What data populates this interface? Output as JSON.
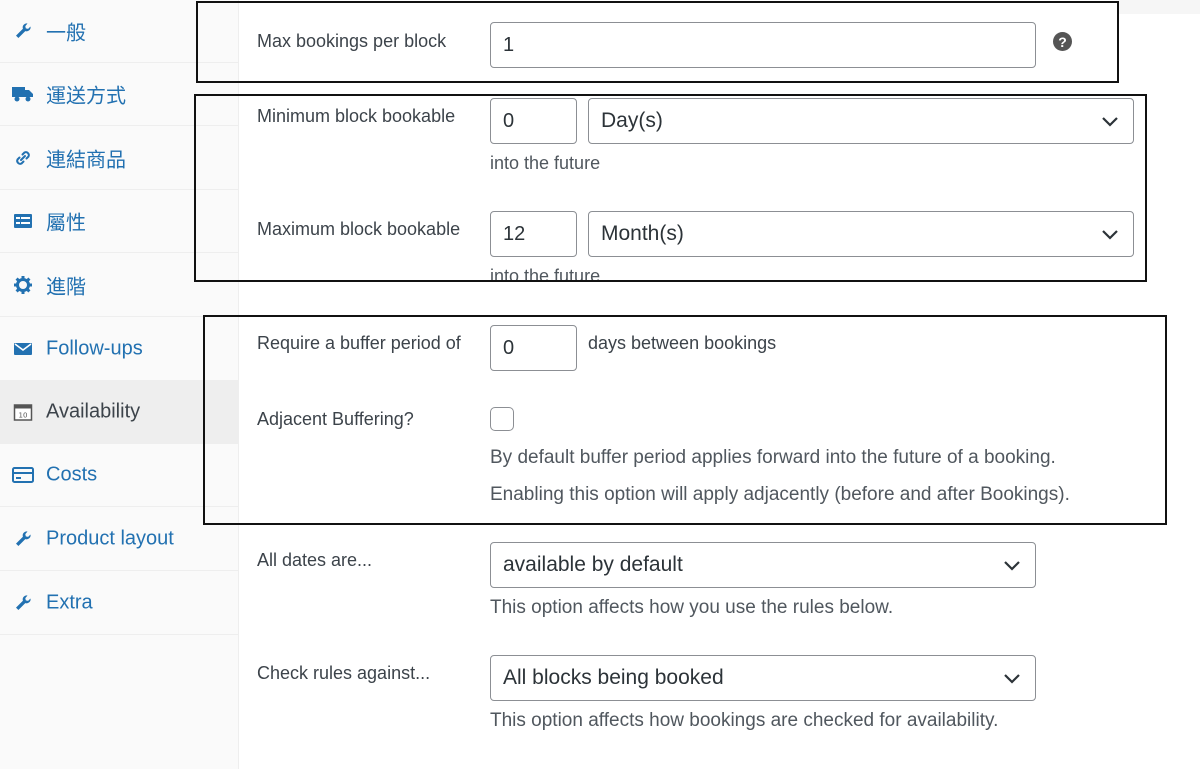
{
  "sidebar": {
    "items": [
      {
        "label": "一般",
        "icon": "wrench-icon"
      },
      {
        "label": "運送方式",
        "icon": "truck-icon"
      },
      {
        "label": "連結商品",
        "icon": "link-icon"
      },
      {
        "label": "屬性",
        "icon": "list-icon"
      },
      {
        "label": "進階",
        "icon": "gear-icon"
      },
      {
        "label": "Follow-ups",
        "icon": "envelope-icon"
      },
      {
        "label": "Availability",
        "icon": "calendar-icon",
        "active": true
      },
      {
        "label": "Costs",
        "icon": "card-icon"
      },
      {
        "label": "Product layout",
        "icon": "wrench-icon"
      },
      {
        "label": "Extra",
        "icon": "wrench-icon"
      }
    ]
  },
  "form": {
    "max_bookings": {
      "label": "Max bookings per block",
      "value": "1"
    },
    "min_bookable": {
      "label": "Minimum block bookable",
      "value": "0",
      "unit": "Day(s)",
      "hint": "into the future"
    },
    "max_bookable": {
      "label": "Maximum block bookable",
      "value": "12",
      "unit": "Month(s)",
      "hint": "into the future"
    },
    "buffer": {
      "label": "Require a buffer period of",
      "value": "0",
      "suffix": "days between bookings"
    },
    "adjacent": {
      "label": "Adjacent Buffering?",
      "checked": false,
      "hint1": "By default buffer period applies forward into the future of a booking.",
      "hint2": "Enabling this option will apply adjacently (before and after Bookings)."
    },
    "all_dates": {
      "label": "All dates are...",
      "value": "available by default",
      "hint": "This option affects how you use the rules below."
    },
    "check_rules": {
      "label": "Check rules against...",
      "value": "All blocks being booked",
      "hint": "This option affects how bookings are checked for availability."
    }
  },
  "colors": {
    "link": "#2271b1",
    "text": "#3c434a",
    "frame": "#111111"
  }
}
